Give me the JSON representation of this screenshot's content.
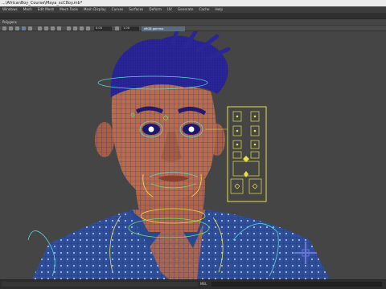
{
  "window": {
    "title": "...\\AfricanBoy_Course\\Maya_scC8oy.mb*"
  },
  "menubar": {
    "items": [
      "Windows",
      "Mesh",
      "Edit Mesh",
      "Mesh Tools",
      "Mesh Display",
      "Curves",
      "Surfaces",
      "Deform",
      "UV",
      "Generate",
      "Cache",
      "Help"
    ]
  },
  "shelf": {
    "label": "Polygons"
  },
  "toolbar": {
    "field_1": "0.00",
    "field_2": "1.00",
    "colorspace": "sRGB gamma"
  },
  "bottombar": {
    "mel_label": "MEL"
  },
  "colors": {
    "viewport_bg": "#454545",
    "wire_face": "#3a2a9e",
    "skin": "#b26a47",
    "control_yellow": "#e8e04a",
    "control_cyan": "#58d8d8",
    "control_green": "#6ee06e"
  },
  "icons": [
    "viewport-select-icon",
    "snap-icon",
    "camera-icon",
    "grid-icon",
    "shading-icon",
    "manipulator-cross-icon"
  ]
}
